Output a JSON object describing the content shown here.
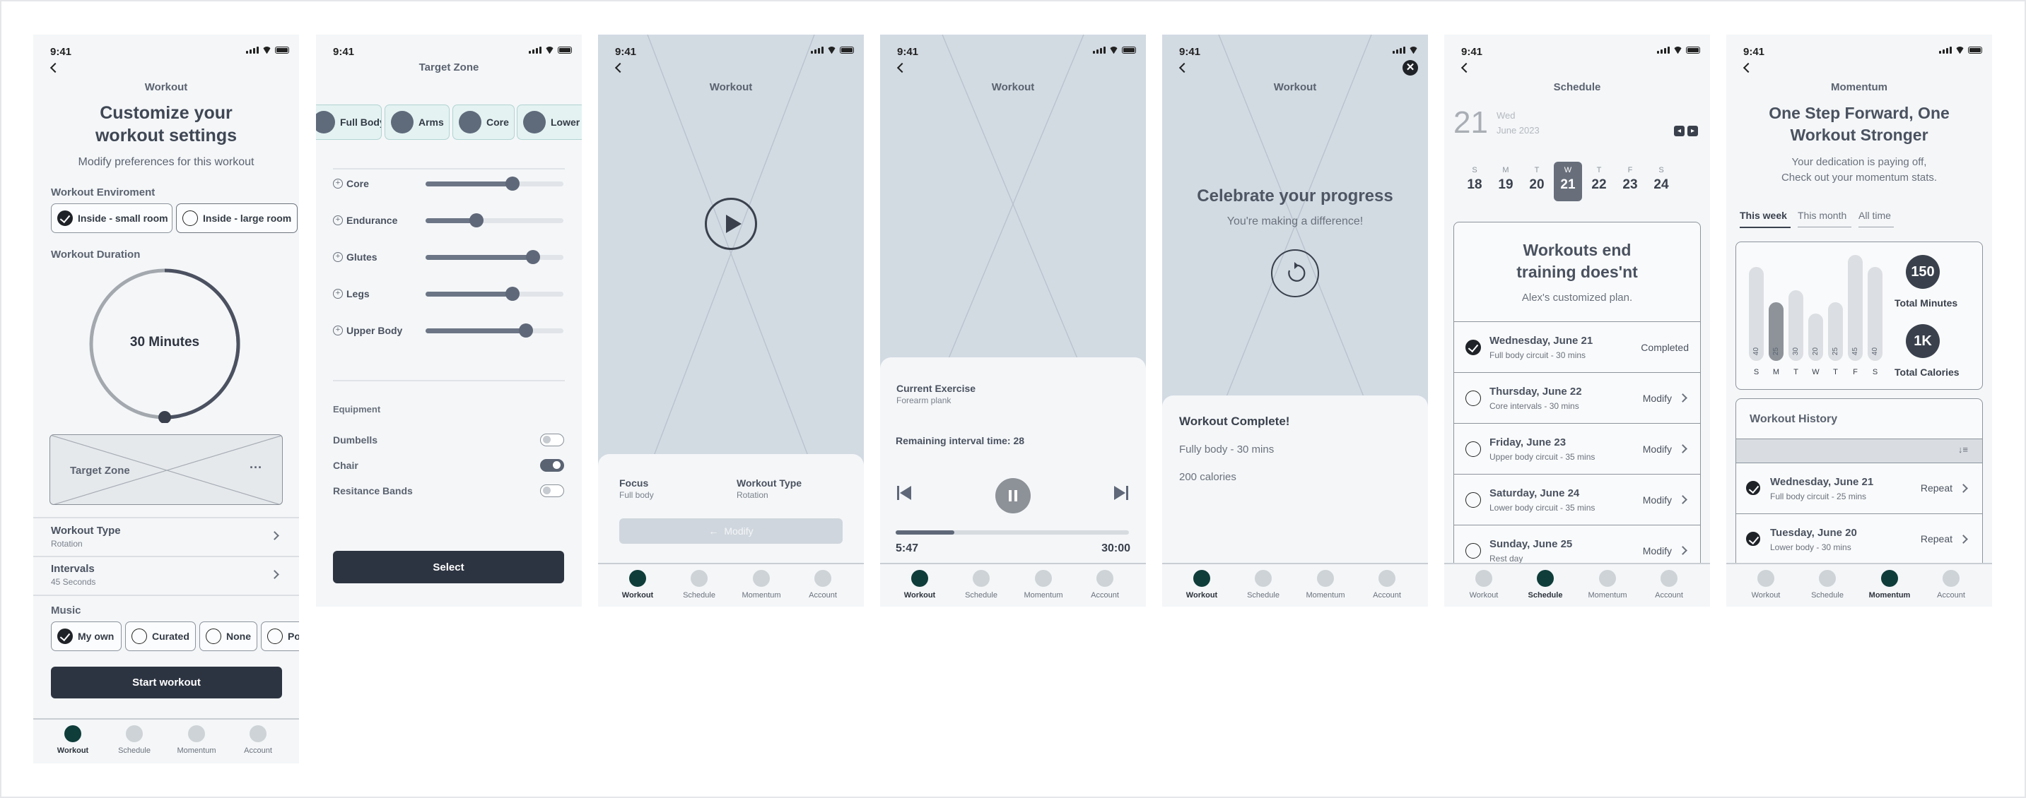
{
  "status_time": "9:41",
  "nav": [
    "Workout",
    "Schedule",
    "Momentum",
    "Account"
  ],
  "s1": {
    "header": "Workout",
    "title_l1": "Customize your",
    "title_l2": "workout settings",
    "subtitle": "Modify preferences for this workout",
    "env_label": "Workout Enviroment",
    "env_opt1": "Inside - small room",
    "env_opt2": "Inside - large room",
    "duration_label": "Workout Duration",
    "duration_value": "30 Minutes",
    "target_zone": "Target Zone",
    "target_more": "···",
    "type_label": "Workout Type",
    "type_value": "Rotation",
    "intervals_label": "Intervals",
    "intervals_value": "45 Seconds",
    "music_label": "Music",
    "music_opts": [
      "My own",
      "Curated",
      "None",
      "Pop"
    ],
    "start": "Start workout"
  },
  "s2": {
    "header": "Target Zone",
    "zones": [
      "Full Body",
      "Arms",
      "Core",
      "Lower b"
    ],
    "sliders": [
      {
        "label": "Core",
        "value": 0.63
      },
      {
        "label": "Endurance",
        "value": 0.37
      },
      {
        "label": "Glutes",
        "value": 0.78
      },
      {
        "label": "Legs",
        "value": 0.63
      },
      {
        "label": "Upper Body",
        "value": 0.73
      }
    ],
    "equipment_label": "Equipment",
    "equipment": [
      {
        "label": "Dumbells",
        "on": false
      },
      {
        "label": "Chair",
        "on": true
      },
      {
        "label": "Resitance Bands",
        "on": false
      }
    ],
    "select": "Select"
  },
  "s3": {
    "header": "Workout",
    "focus_label": "Focus",
    "focus_value": "Full body",
    "type_label": "Workout Type",
    "type_value": "Rotation",
    "modify": "Modify",
    "arrow": "←"
  },
  "s4": {
    "header": "Workout",
    "ex_label": "Current Exercise",
    "ex_value": "Forearm plank",
    "remaining": "Remaining interval time: 28",
    "elapsed": "5:47",
    "total": "30:00",
    "progress": 0.25
  },
  "s5": {
    "header": "Workout",
    "celebrate": "Celebrate your progress",
    "difference": "You're making a difference!",
    "complete": "Workout Complete!",
    "line1": "Fully body - 30 mins",
    "line2": "200 calories"
  },
  "s6": {
    "header": "Schedule",
    "day": "21",
    "weekday": "Wed",
    "month": "June 2023",
    "week": [
      {
        "l": "S",
        "d": "18"
      },
      {
        "l": "M",
        "d": "19"
      },
      {
        "l": "T",
        "d": "20"
      },
      {
        "l": "W",
        "d": "21"
      },
      {
        "l": "T",
        "d": "22"
      },
      {
        "l": "F",
        "d": "23"
      },
      {
        "l": "S",
        "d": "24"
      }
    ],
    "card_l1": "Workouts end",
    "card_l2": "training does'nt",
    "card_sub": "Alex's customized plan.",
    "items": [
      {
        "title": "Wednesday, June 21",
        "sub": "Full body circuit - 30 mins",
        "action": "Completed",
        "done": true
      },
      {
        "title": "Thursday, June 22",
        "sub": "Core intervals - 30 mins",
        "action": "Modify",
        "done": false
      },
      {
        "title": "Friday, June 23",
        "sub": "Upper body circuit - 35 mins",
        "action": "Modify",
        "done": false
      },
      {
        "title": "Saturday, June 24",
        "sub": "Lower body circuit - 35 mins",
        "action": "Modify",
        "done": false
      },
      {
        "title": "Sunday, June 25",
        "sub": "Rest day",
        "action": "Modify",
        "done": false
      }
    ]
  },
  "s7": {
    "header": "Momentum",
    "title_l1": "One Step Forward, One",
    "title_l2": "Workout Stronger",
    "sub_l1": "Your dedication is paying off,",
    "sub_l2": "Check out your momentum stats.",
    "tabs": [
      "This week",
      "This month",
      "All time"
    ],
    "bars": [
      {
        "day": "S",
        "v": 40
      },
      {
        "day": "M",
        "v": 25
      },
      {
        "day": "T",
        "v": 30
      },
      {
        "day": "W",
        "v": 20
      },
      {
        "day": "T",
        "v": 25
      },
      {
        "day": "F",
        "v": 45
      },
      {
        "day": "S",
        "v": 40
      }
    ],
    "minutes": "150",
    "minutes_label": "Total Minutes",
    "calories": "1K",
    "calories_label": "Total Calories",
    "history_title": "Workout History",
    "history": [
      {
        "title": "Wednesday, June 21",
        "sub": "Full body circuit - 25 mins",
        "action": "Repeat"
      },
      {
        "title": "Tuesday, June 20",
        "sub": "Lower body - 30 mins",
        "action": "Repeat"
      }
    ]
  }
}
